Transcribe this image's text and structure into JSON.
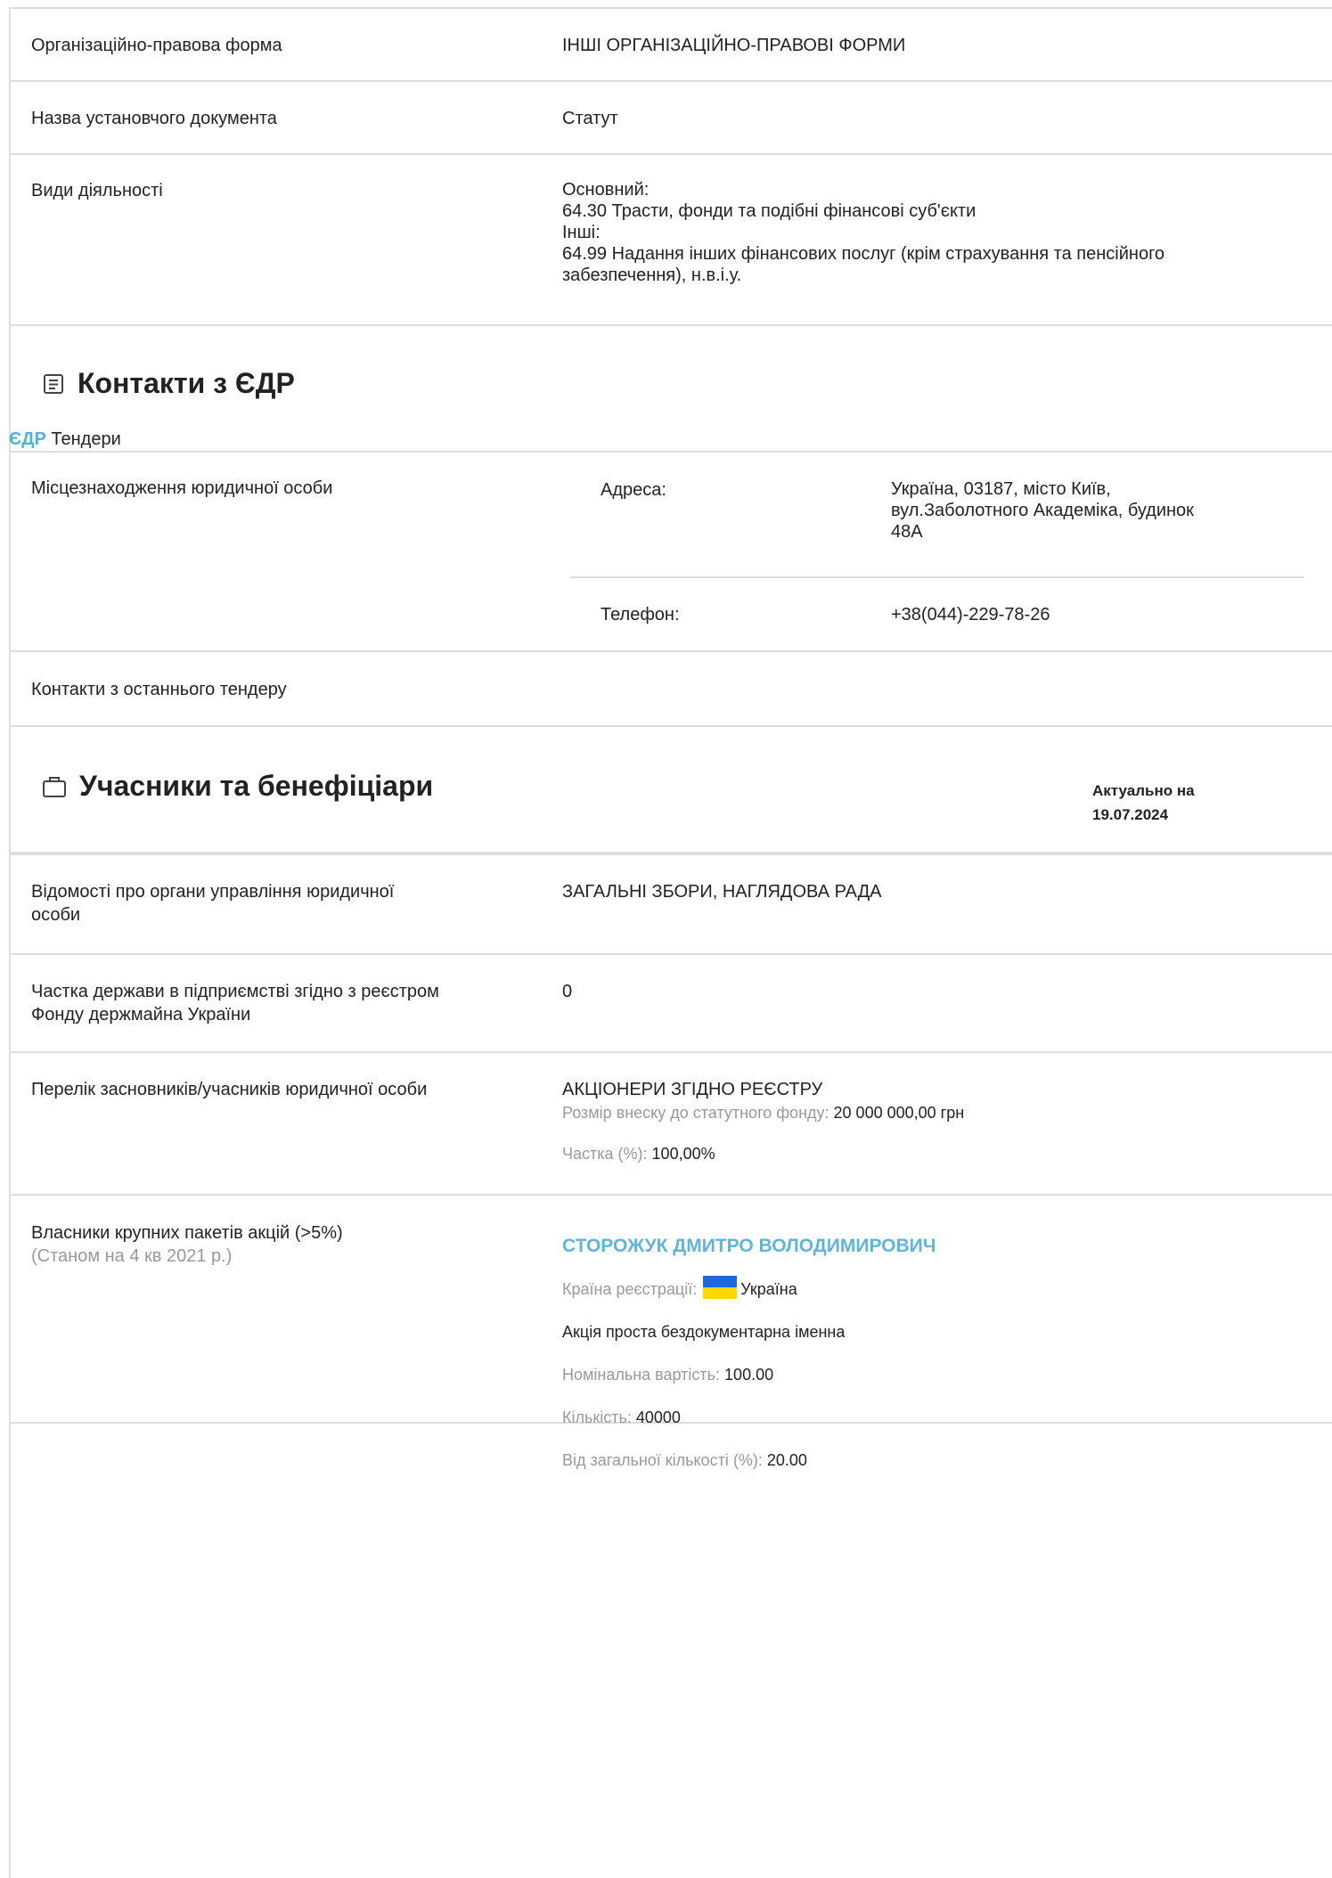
{
  "registry": {
    "org_form_label": "Організаційно-правова форма",
    "org_form_value": "ІНШІ ОРГАНІЗАЦІЙНО-ПРАВОВІ ФОРМИ",
    "founding_doc_label": "Назва установчого документа",
    "founding_doc_value": "Статут",
    "activities_label": "Види діяльності",
    "activities_main_label": "Основний:",
    "activities_main": "64.30 Трасти, фонди та подібні фінансові суб'єкти",
    "activities_other_label": "Інші:",
    "activities_other_1": "64.99 Надання інших фінансових послуг (крім страхування та пенсійного",
    "activities_other_2": "забезпечення), н.в.і.у."
  },
  "contacts": {
    "title": "Контакти з ЄДР",
    "icon": "document-list-icon",
    "tabs": [
      "ЄДР",
      "Тендери"
    ],
    "location_label": "Місцезнаходження юридичної особи",
    "address_label": "Адреса:",
    "address_line_1": "Україна, 03187, місто Київ,",
    "address_line_2": "вул.Заболотного Академіка, будинок",
    "address_line_3": "48А",
    "phone_label": "Телефон:",
    "phone_value": "+38(044)-229-78-26",
    "tender_contacts_label": "Контакти з останнього тендеру"
  },
  "participants": {
    "title": "Учасники та бенефіціари",
    "icon": "briefcase-icon",
    "as_of_label": "Актуально на",
    "as_of_date": "19.07.2024",
    "governing_label_1": "Відомості про органи управління юридичної",
    "governing_label_2": "особи",
    "governing_value": "ЗАГАЛЬНІ ЗБОРИ, НАГЛЯДОВА РАДА",
    "state_share_label_1": "Частка держави в підприємстві згідно з реєстром",
    "state_share_label_2": "Фонду держмайна України",
    "state_share_value": "0",
    "founders_label": "Перелік засновників/учасників юридичної особи",
    "founder_name": "АКЦІОНЕРИ ЗГІДНО РЕЄСТРУ",
    "contribution_label": "Розмір внеску до статутного фонду:",
    "contribution_value": "20 000 000,00 грн",
    "share_label": "Частка (%):",
    "share_value": "100,00%",
    "shareholders_label": "Власники крупних пакетів акцій (>5%)",
    "shareholders_note": "(Станом на 4 кв 2021 р.)",
    "owner_name": "СТОРОЖУК ДМИТРО ВОЛОДИМИРОВИЧ",
    "country_label": "Країна реєстрації:",
    "country_value": "Україна",
    "share_type": "Акція проста бездокументарна іменна",
    "nominal_label": "Номінальна вартість:",
    "nominal_value": "100.00",
    "quantity_label": "Кількість:",
    "quantity_value": "40000",
    "percent_label": "Від загальної кількості (%):",
    "percent_value": "20.00"
  }
}
